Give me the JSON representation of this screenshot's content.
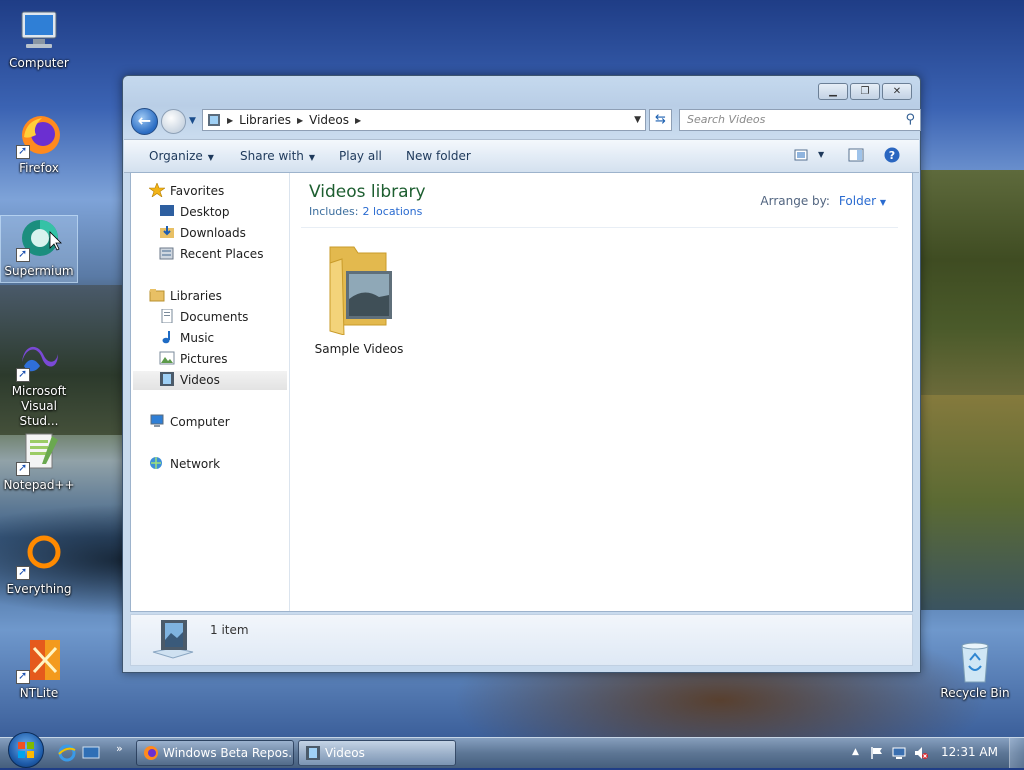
{
  "desktop": {
    "icons": [
      {
        "label": "Computer"
      },
      {
        "label": "Firefox"
      },
      {
        "label": "Supermium"
      },
      {
        "label": "Microsoft Visual Stud..."
      },
      {
        "label": "Notepad++"
      },
      {
        "label": "Everything"
      },
      {
        "label": "NTLite"
      },
      {
        "label": "Recycle Bin"
      }
    ]
  },
  "window": {
    "address": {
      "crumbs": [
        "Libraries",
        "Videos"
      ]
    },
    "search_placeholder": "Search Videos",
    "toolbar": {
      "organize": "Organize",
      "share_with": "Share with",
      "play_all": "Play all",
      "new_folder": "New folder"
    },
    "nav": {
      "favorites": "Favorites",
      "desktop": "Desktop",
      "downloads": "Downloads",
      "recent_places": "Recent Places",
      "libraries": "Libraries",
      "documents": "Documents",
      "music": "Music",
      "pictures": "Pictures",
      "videos": "Videos",
      "computer": "Computer",
      "network": "Network"
    },
    "library": {
      "title": "Videos library",
      "includes_label": "Includes:",
      "includes_link": "2 locations",
      "arrange_label": "Arrange by:",
      "arrange_value": "Folder"
    },
    "items": [
      {
        "label": "Sample Videos"
      }
    ],
    "details": {
      "count": "1 item"
    }
  },
  "taskbar": {
    "tasks": [
      {
        "label": "Windows Beta Repos..."
      },
      {
        "label": "Videos"
      }
    ],
    "clock": "12:31 AM"
  },
  "colors": {
    "library_title": "#1d5e30",
    "link": "#2a6bd0"
  }
}
